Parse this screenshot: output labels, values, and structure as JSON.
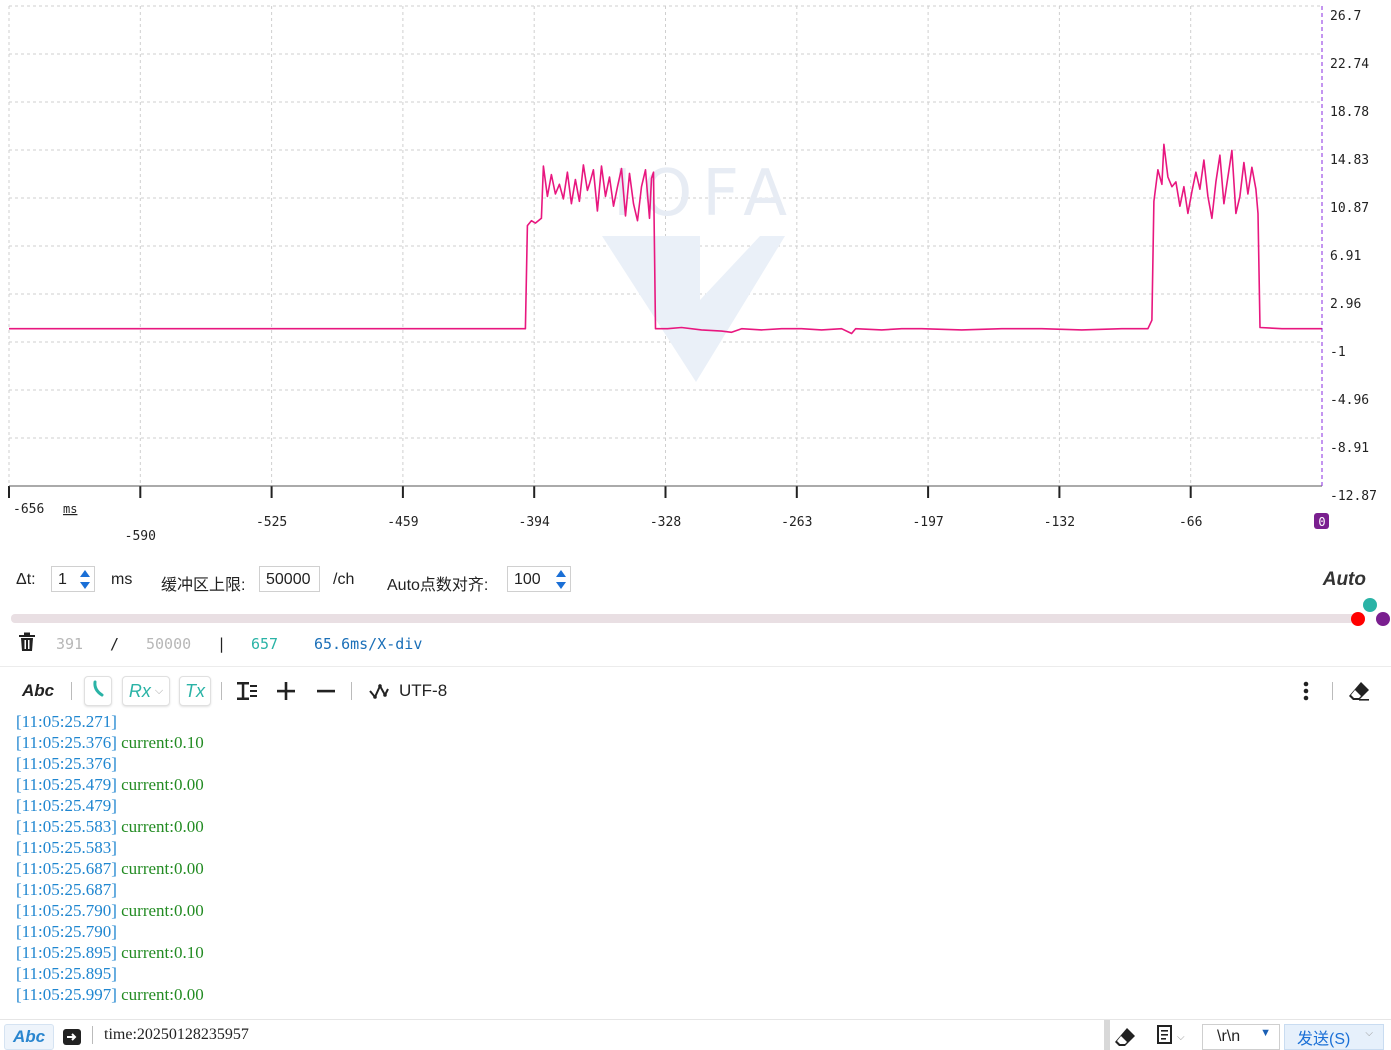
{
  "chart_data": {
    "type": "line",
    "x_range": [
      -656,
      0
    ],
    "x_unit": "ms",
    "y_range": [
      -12.87,
      26.7
    ],
    "y_tick_labels": [
      "26.7",
      "22.74",
      "18.78",
      "14.83",
      "10.87",
      "6.91",
      "2.96",
      "-1",
      "-4.96",
      "-8.91",
      "-12.87"
    ],
    "x_tick_labels": [
      "-656",
      "-590",
      "-525",
      "-459",
      "-394",
      "-328",
      "-263",
      "-197",
      "-132",
      "-66",
      "0"
    ],
    "x_unit_label": "ms",
    "grid": true,
    "watermark": "IOFA",
    "series": [
      {
        "color": "#e8177f",
        "points": [
          [
            -656,
            0.1
          ],
          [
            -398,
            0.1
          ],
          [
            -397,
            8.6
          ],
          [
            -395,
            9.0
          ],
          [
            -393,
            8.8
          ],
          [
            -390,
            9.2
          ],
          [
            -389,
            13.5
          ],
          [
            -387,
            11.0
          ],
          [
            -385,
            12.8
          ],
          [
            -383,
            11.2
          ],
          [
            -381,
            12.0
          ],
          [
            -379,
            10.8
          ],
          [
            -377,
            13.0
          ],
          [
            -375,
            10.4
          ],
          [
            -373,
            12.4
          ],
          [
            -371,
            10.6
          ],
          [
            -369,
            13.6
          ],
          [
            -367,
            11.5
          ],
          [
            -366,
            12.0
          ],
          [
            -364,
            13.2
          ],
          [
            -362,
            9.8
          ],
          [
            -360,
            13.5
          ],
          [
            -358,
            11.0
          ],
          [
            -356,
            12.6
          ],
          [
            -354,
            10.2
          ],
          [
            -352,
            11.8
          ],
          [
            -350,
            13.3
          ],
          [
            -348,
            9.4
          ],
          [
            -346,
            12.9
          ],
          [
            -344,
            10.4
          ],
          [
            -342,
            9.0
          ],
          [
            -340,
            11.8
          ],
          [
            -338,
            13.2
          ],
          [
            -336,
            9.2
          ],
          [
            -335,
            12.5
          ],
          [
            -334,
            13.0
          ],
          [
            -333,
            0.1
          ],
          [
            -327,
            0.1
          ],
          [
            -320,
            0.2
          ],
          [
            -310,
            0.0
          ],
          [
            -300,
            -0.1
          ],
          [
            -295,
            -0.2
          ],
          [
            -290,
            0.1
          ],
          [
            -280,
            0.0
          ],
          [
            -270,
            0.1
          ],
          [
            -260,
            0.1
          ],
          [
            -250,
            0.0
          ],
          [
            -240,
            0.1
          ],
          [
            -235,
            -0.3
          ],
          [
            -233,
            0.1
          ],
          [
            -220,
            0.0
          ],
          [
            -210,
            0.1
          ],
          [
            -200,
            0.1
          ],
          [
            -180,
            0.0
          ],
          [
            -160,
            0.1
          ],
          [
            -140,
            0.1
          ],
          [
            -120,
            0.0
          ],
          [
            -100,
            0.1
          ],
          [
            -87,
            0.1
          ],
          [
            -85,
            0.8
          ],
          [
            -84,
            10.6
          ],
          [
            -82,
            13.2
          ],
          [
            -80,
            12.0
          ],
          [
            -79,
            15.3
          ],
          [
            -77,
            12.6
          ],
          [
            -75,
            11.8
          ],
          [
            -73,
            12.2
          ],
          [
            -71,
            10.2
          ],
          [
            -69,
            11.8
          ],
          [
            -67,
            9.6
          ],
          [
            -65,
            11.4
          ],
          [
            -63,
            13.0
          ],
          [
            -61,
            11.6
          ],
          [
            -59,
            14.0
          ],
          [
            -57,
            11.0
          ],
          [
            -55,
            9.2
          ],
          [
            -53,
            12.2
          ],
          [
            -51,
            14.4
          ],
          [
            -49,
            10.4
          ],
          [
            -47,
            12.6
          ],
          [
            -45,
            14.8
          ],
          [
            -43,
            9.6
          ],
          [
            -41,
            11.0
          ],
          [
            -39,
            13.8
          ],
          [
            -37,
            11.2
          ],
          [
            -35,
            13.4
          ],
          [
            -33,
            11.6
          ],
          [
            -32,
            9.6
          ],
          [
            -31,
            0.2
          ],
          [
            -20,
            0.1
          ],
          [
            -10,
            0.1
          ],
          [
            0,
            0.1
          ]
        ]
      }
    ]
  },
  "settings": {
    "dt_label": "Δt:",
    "dt_value": "1",
    "dt_unit": "ms",
    "buffer_label": "缓冲区上限:",
    "buffer_value": "50000",
    "buffer_unit": "/ch",
    "auto_align_label": "Auto点数对齐:",
    "auto_align_value": "100",
    "auto_label": "Auto"
  },
  "slider": {
    "dot_colors": [
      "#ff0000",
      "#2ab3a6",
      "#7a1f8f"
    ]
  },
  "status": {
    "count": "391",
    "slash": "/",
    "max": "50000",
    "pipe": "|",
    "points": "657",
    "scale": "65.6ms/X-div"
  },
  "toolbar": {
    "abc_label": "Abc",
    "rx_label": "Rx",
    "tx_label": "Tx",
    "encoding": "UTF-8"
  },
  "log": [
    {
      "ts": "[11:05:25.271]",
      "msg": ""
    },
    {
      "ts": "[11:05:25.376]",
      "msg": "current:0.10"
    },
    {
      "ts": "[11:05:25.376]",
      "msg": ""
    },
    {
      "ts": "[11:05:25.479]",
      "msg": "current:0.00"
    },
    {
      "ts": "[11:05:25.479]",
      "msg": ""
    },
    {
      "ts": "[11:05:25.583]",
      "msg": "current:0.00"
    },
    {
      "ts": "[11:05:25.583]",
      "msg": ""
    },
    {
      "ts": "[11:05:25.687]",
      "msg": "current:0.00"
    },
    {
      "ts": "[11:05:25.687]",
      "msg": ""
    },
    {
      "ts": "[11:05:25.790]",
      "msg": "current:0.00"
    },
    {
      "ts": "[11:05:25.790]",
      "msg": ""
    },
    {
      "ts": "[11:05:25.895]",
      "msg": "current:0.10"
    },
    {
      "ts": "[11:05:25.895]",
      "msg": ""
    },
    {
      "ts": "[11:05:25.997]",
      "msg": "current:0.00"
    }
  ],
  "bottom": {
    "abc_label": "Abc",
    "input_value": "time:20250128235957",
    "line_ending": "\\r\\n",
    "send_label": "发送(S)"
  }
}
